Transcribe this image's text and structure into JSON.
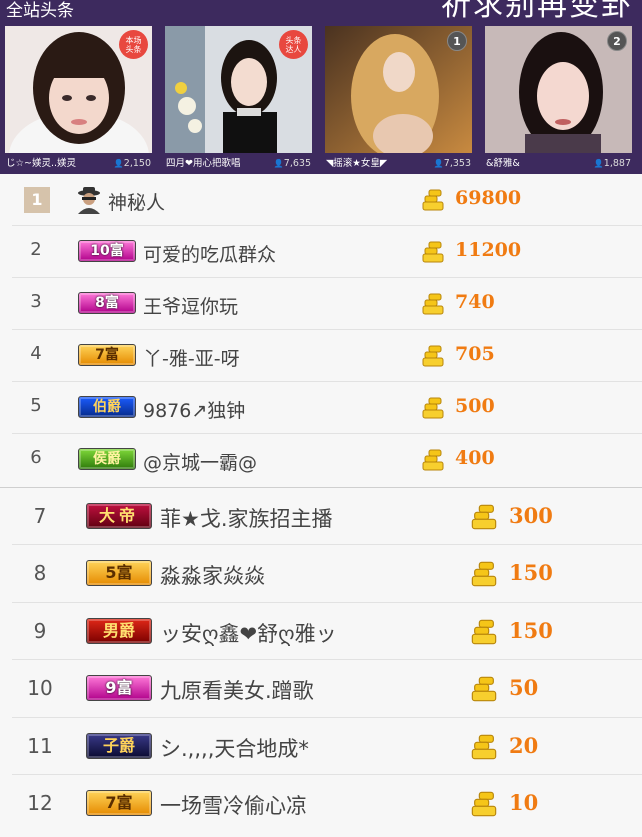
{
  "banner": {
    "title": "全站头条",
    "marquee": "祈求别再变卦"
  },
  "cards": [
    {
      "badge": "本场\n头条",
      "name": "じ☆~媄灵..媄灵",
      "count": "2,150",
      "badge_type": "tag"
    },
    {
      "badge": "头条\n达人",
      "name": "四月❤用心把歌唱",
      "count": "7,635",
      "badge_type": "tag"
    },
    {
      "badge": "1",
      "name": "◥摇滚★女皇◤",
      "count": "7,353",
      "badge_type": "rank"
    },
    {
      "badge": "2",
      "name": "&舒雅&",
      "count": "1,887",
      "badge_type": "rank"
    }
  ],
  "ranking": [
    {
      "rank": "1",
      "level": "",
      "name": "神秘人",
      "amount": "69800"
    },
    {
      "rank": "2",
      "level": "10富",
      "name": "可爱的吃瓜群众",
      "amount": "11200"
    },
    {
      "rank": "3",
      "level": "8富",
      "name": "王爷逗你玩",
      "amount": "740"
    },
    {
      "rank": "4",
      "level": "7富",
      "name": "丫-雅-亚-呀",
      "amount": "705"
    },
    {
      "rank": "5",
      "level": "伯爵",
      "name": "9876↗独钟",
      "amount": "500"
    },
    {
      "rank": "6",
      "level": "侯爵",
      "name": "@京城一霸@",
      "amount": "400"
    },
    {
      "rank": "7",
      "level": "大帝",
      "name": "菲★戈.家族招主播",
      "amount": "300"
    },
    {
      "rank": "8",
      "level": "5富",
      "name": "淼淼家焱焱",
      "amount": "150"
    },
    {
      "rank": "9",
      "level": "男爵",
      "name": "ッ安ღ鑫❤舒ღ雅ッ",
      "amount": "150"
    },
    {
      "rank": "10",
      "level": "9富",
      "name": "九原看美女.蹭歌",
      "amount": "50"
    },
    {
      "rank": "11",
      "level": "子爵",
      "name": "シ.,,,,天合地成*",
      "amount": "20"
    },
    {
      "rank": "12",
      "level": "7富",
      "name": "一场雪冷偷心凉",
      "amount": "10"
    }
  ],
  "icons": {
    "coin": "gold-coin-stack-icon",
    "anon": "mystery-man-icon",
    "person": "person-icon"
  },
  "colors": {
    "banner_bg": "#3d2a5e",
    "amount": "#f07b12",
    "badge_red": "#e8483f"
  }
}
